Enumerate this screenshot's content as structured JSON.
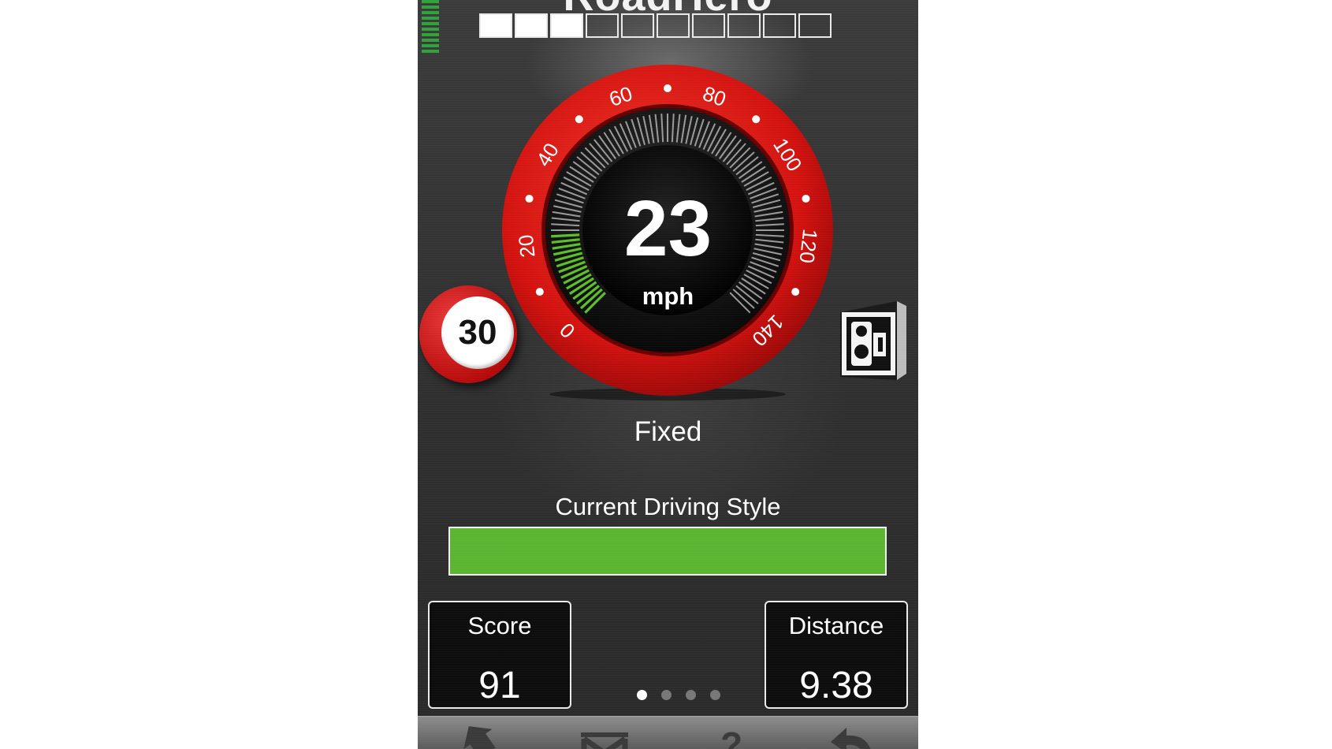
{
  "header": {
    "title": "RoadHero",
    "progress": {
      "filled": 3,
      "total": 10
    }
  },
  "speedometer": {
    "speed": "23",
    "unit": "mph",
    "dial_labels": [
      "0",
      "20",
      "40",
      "60",
      "80",
      "100",
      "120",
      "140"
    ],
    "max": 140,
    "ring_color": "#d3120f"
  },
  "speed_limit": {
    "value": "30"
  },
  "camera": {
    "icon": "speed-camera-icon",
    "type": "Fixed"
  },
  "driving_style": {
    "label": "Current Driving Style",
    "level": 1.0,
    "color": "#5cb531"
  },
  "stats": {
    "score": {
      "label": "Score",
      "value": "91"
    },
    "distance": {
      "label": "Distance",
      "value": "9.38"
    }
  },
  "pager": {
    "count": 4,
    "active": 0
  },
  "toolbar": {
    "icons": [
      "back-arrow-icon",
      "route-icon",
      "help-icon",
      "return-icon"
    ],
    "help_glyph": "?"
  }
}
